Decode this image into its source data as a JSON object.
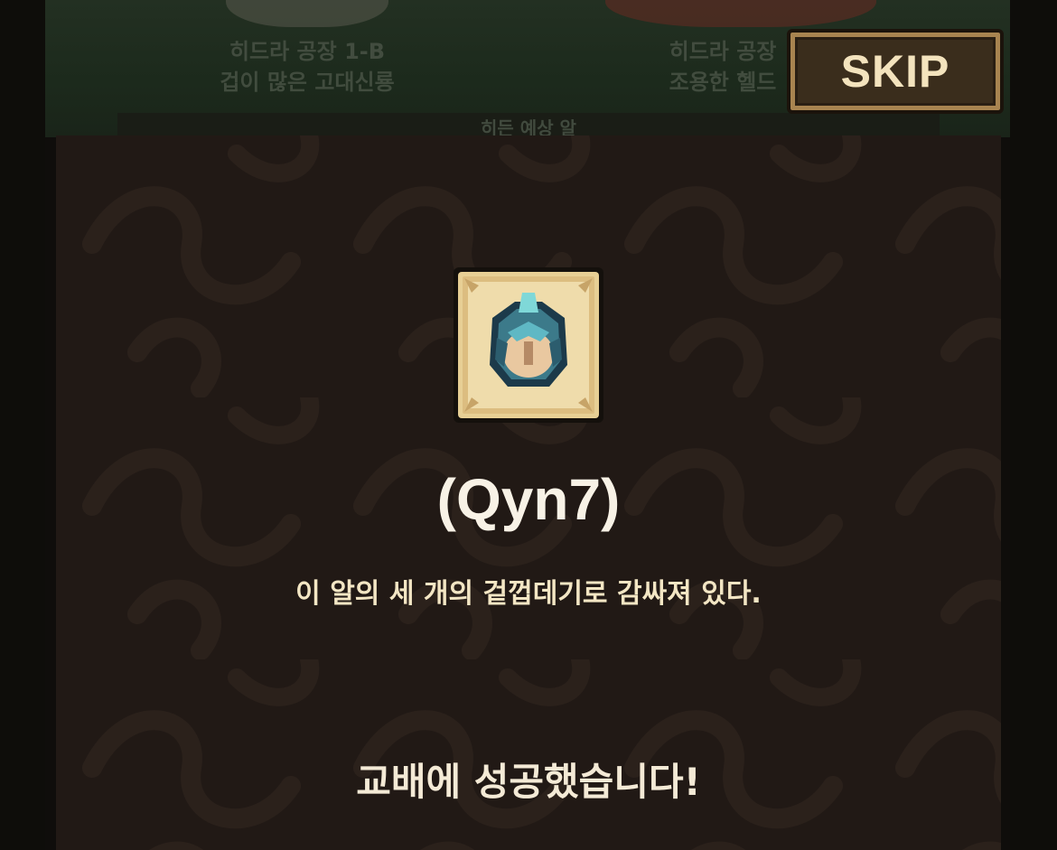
{
  "skip_button": {
    "label": "SKIP"
  },
  "background": {
    "stage_left": {
      "line1": "히드라 공장 1-B",
      "line2": "겁이 많은 고대신룡"
    },
    "stage_right": {
      "line1": "히드라 공장",
      "line2": "조용한 헬드"
    },
    "hint_bar": "히든 예상 알"
  },
  "item": {
    "icon": "egg-icon",
    "name": "(Qyn7)",
    "description": "이 알의 세 개의 겉껍데기로 감싸져 있다."
  },
  "result": {
    "message": "교배에 성공했습니다!"
  },
  "colors": {
    "popup_bg": "#211915",
    "text_primary": "#f8f2e6",
    "text_secondary": "#f3e6c4",
    "button_border": "#a88450"
  }
}
